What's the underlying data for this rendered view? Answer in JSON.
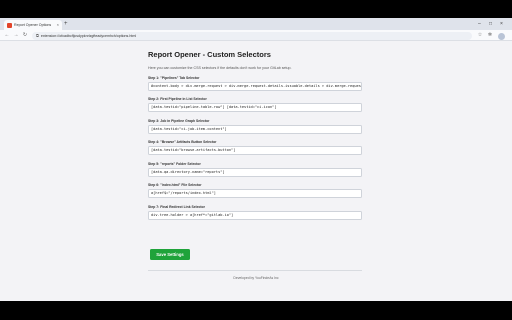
{
  "browser": {
    "tab_title": "Report Opener Options",
    "tab_close": "×",
    "new_tab": "+",
    "url": "extension://ofcadbcfljcsdypknrlzgfteadycemhch/options.html",
    "window_controls": [
      "–",
      "□",
      "×"
    ]
  },
  "page": {
    "title": "Report Opener - Custom Selectors",
    "intro": "Here you can customize the CSS selectors if the defaults don't work for your GitLab setup.",
    "fields": [
      {
        "label": "Step 1: \"Pipelines\" Tab Selector",
        "value": "#content-body > div.merge-request > div.merge-request-details.issuable-details > div.merge-request-tt"
      },
      {
        "label": "Step 2: First Pipeline in List Selector",
        "value": "[data-testid=\"pipeline-table-row\"] [data-testid=\"ci-icon\"]"
      },
      {
        "label": "Step 3: Job in Pipeline Graph Selector",
        "value": "[data-testid=\"ci-job-item-content\"]"
      },
      {
        "label": "Step 4: \"Browse\" Artifacts Button Selector",
        "value": "[data-testid=\"browse-artifacts-button\"]"
      },
      {
        "label": "Step 5: \"reports\" Folder Selector",
        "value": "[data-qa-directory-name=\"reports\"]"
      },
      {
        "label": "Step 6: \"index.html\" File Selector",
        "value": "a[href$=\"/reports/index.html\"]"
      },
      {
        "label": "Step 7: Final Redirect Link Selector",
        "value": "div.tree-holder > a[href*=\"gitlab.io\"]"
      }
    ],
    "save_label": "Save Settings",
    "footer": "Developed by YouFindeAs Inc"
  },
  "colors": {
    "save_button": "#1fa33a",
    "page_background": "#f3f3f6"
  }
}
